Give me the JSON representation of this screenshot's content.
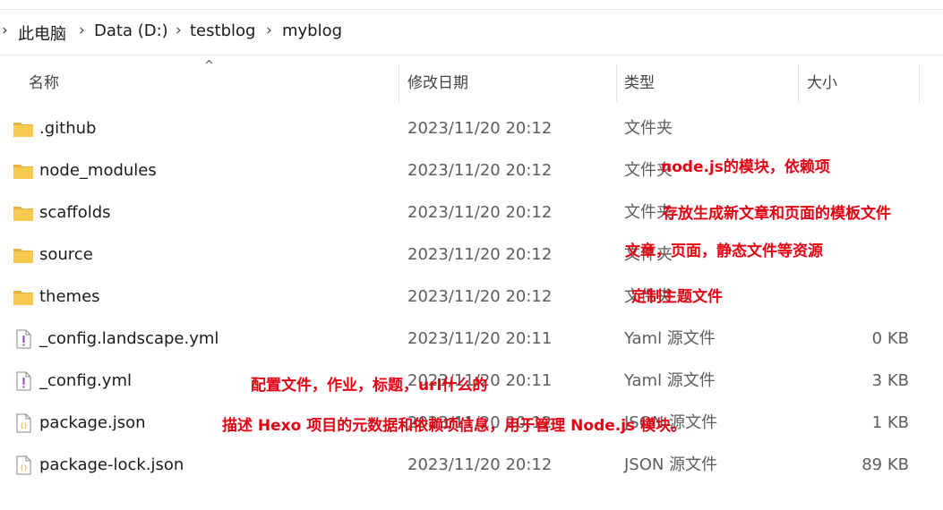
{
  "breadcrumb": {
    "items": [
      "此电脑",
      "Data (D:)",
      "testblog",
      "myblog"
    ]
  },
  "columns": {
    "name": "名称",
    "date": "修改日期",
    "type": "类型",
    "size": "大小",
    "sorted_by": "name"
  },
  "files": [
    {
      "name": ".github",
      "date": "2023/11/20 20:12",
      "type": "文件夹",
      "size": "",
      "icon": "folder-icon"
    },
    {
      "name": "node_modules",
      "date": "2023/11/20 20:12",
      "type": "文件夹",
      "size": "",
      "icon": "folder-icon"
    },
    {
      "name": "scaffolds",
      "date": "2023/11/20 20:12",
      "type": "文件夹",
      "size": "",
      "icon": "folder-icon"
    },
    {
      "name": "source",
      "date": "2023/11/20 20:12",
      "type": "文件夹",
      "size": "",
      "icon": "folder-icon"
    },
    {
      "name": "themes",
      "date": "2023/11/20 20:12",
      "type": "文件夹",
      "size": "",
      "icon": "folder-icon"
    },
    {
      "name": "_config.landscape.yml",
      "date": "2023/11/20 20:11",
      "type": "Yaml 源文件",
      "size": "0 KB",
      "icon": "yaml-file-icon"
    },
    {
      "name": "_config.yml",
      "date": "2023/11/20 20:11",
      "type": "Yaml 源文件",
      "size": "3 KB",
      "icon": "yaml-file-icon"
    },
    {
      "name": "package.json",
      "date": "2023/11/20 20:12",
      "type": "JSON 源文件",
      "size": "1 KB",
      "icon": "json-file-icon"
    },
    {
      "name": "package-lock.json",
      "date": "2023/11/20 20:12",
      "type": "JSON 源文件",
      "size": "89 KB",
      "icon": "json-file-icon"
    }
  ],
  "annotations": {
    "node_modules": "node.js的模块，依赖项",
    "scaffolds": "存放生成新文章和页面的模板文件",
    "source": "文章，页面，静态文件等资源",
    "themes": "定制主题文件",
    "config": "配置文件，作业，标题，url什么的",
    "package": "描述 Hexo 项目的元数据和依赖项信息，用于管理 Node.js 模块。"
  },
  "colors": {
    "annotation": "#e60012",
    "folder": "#f4c64e"
  }
}
